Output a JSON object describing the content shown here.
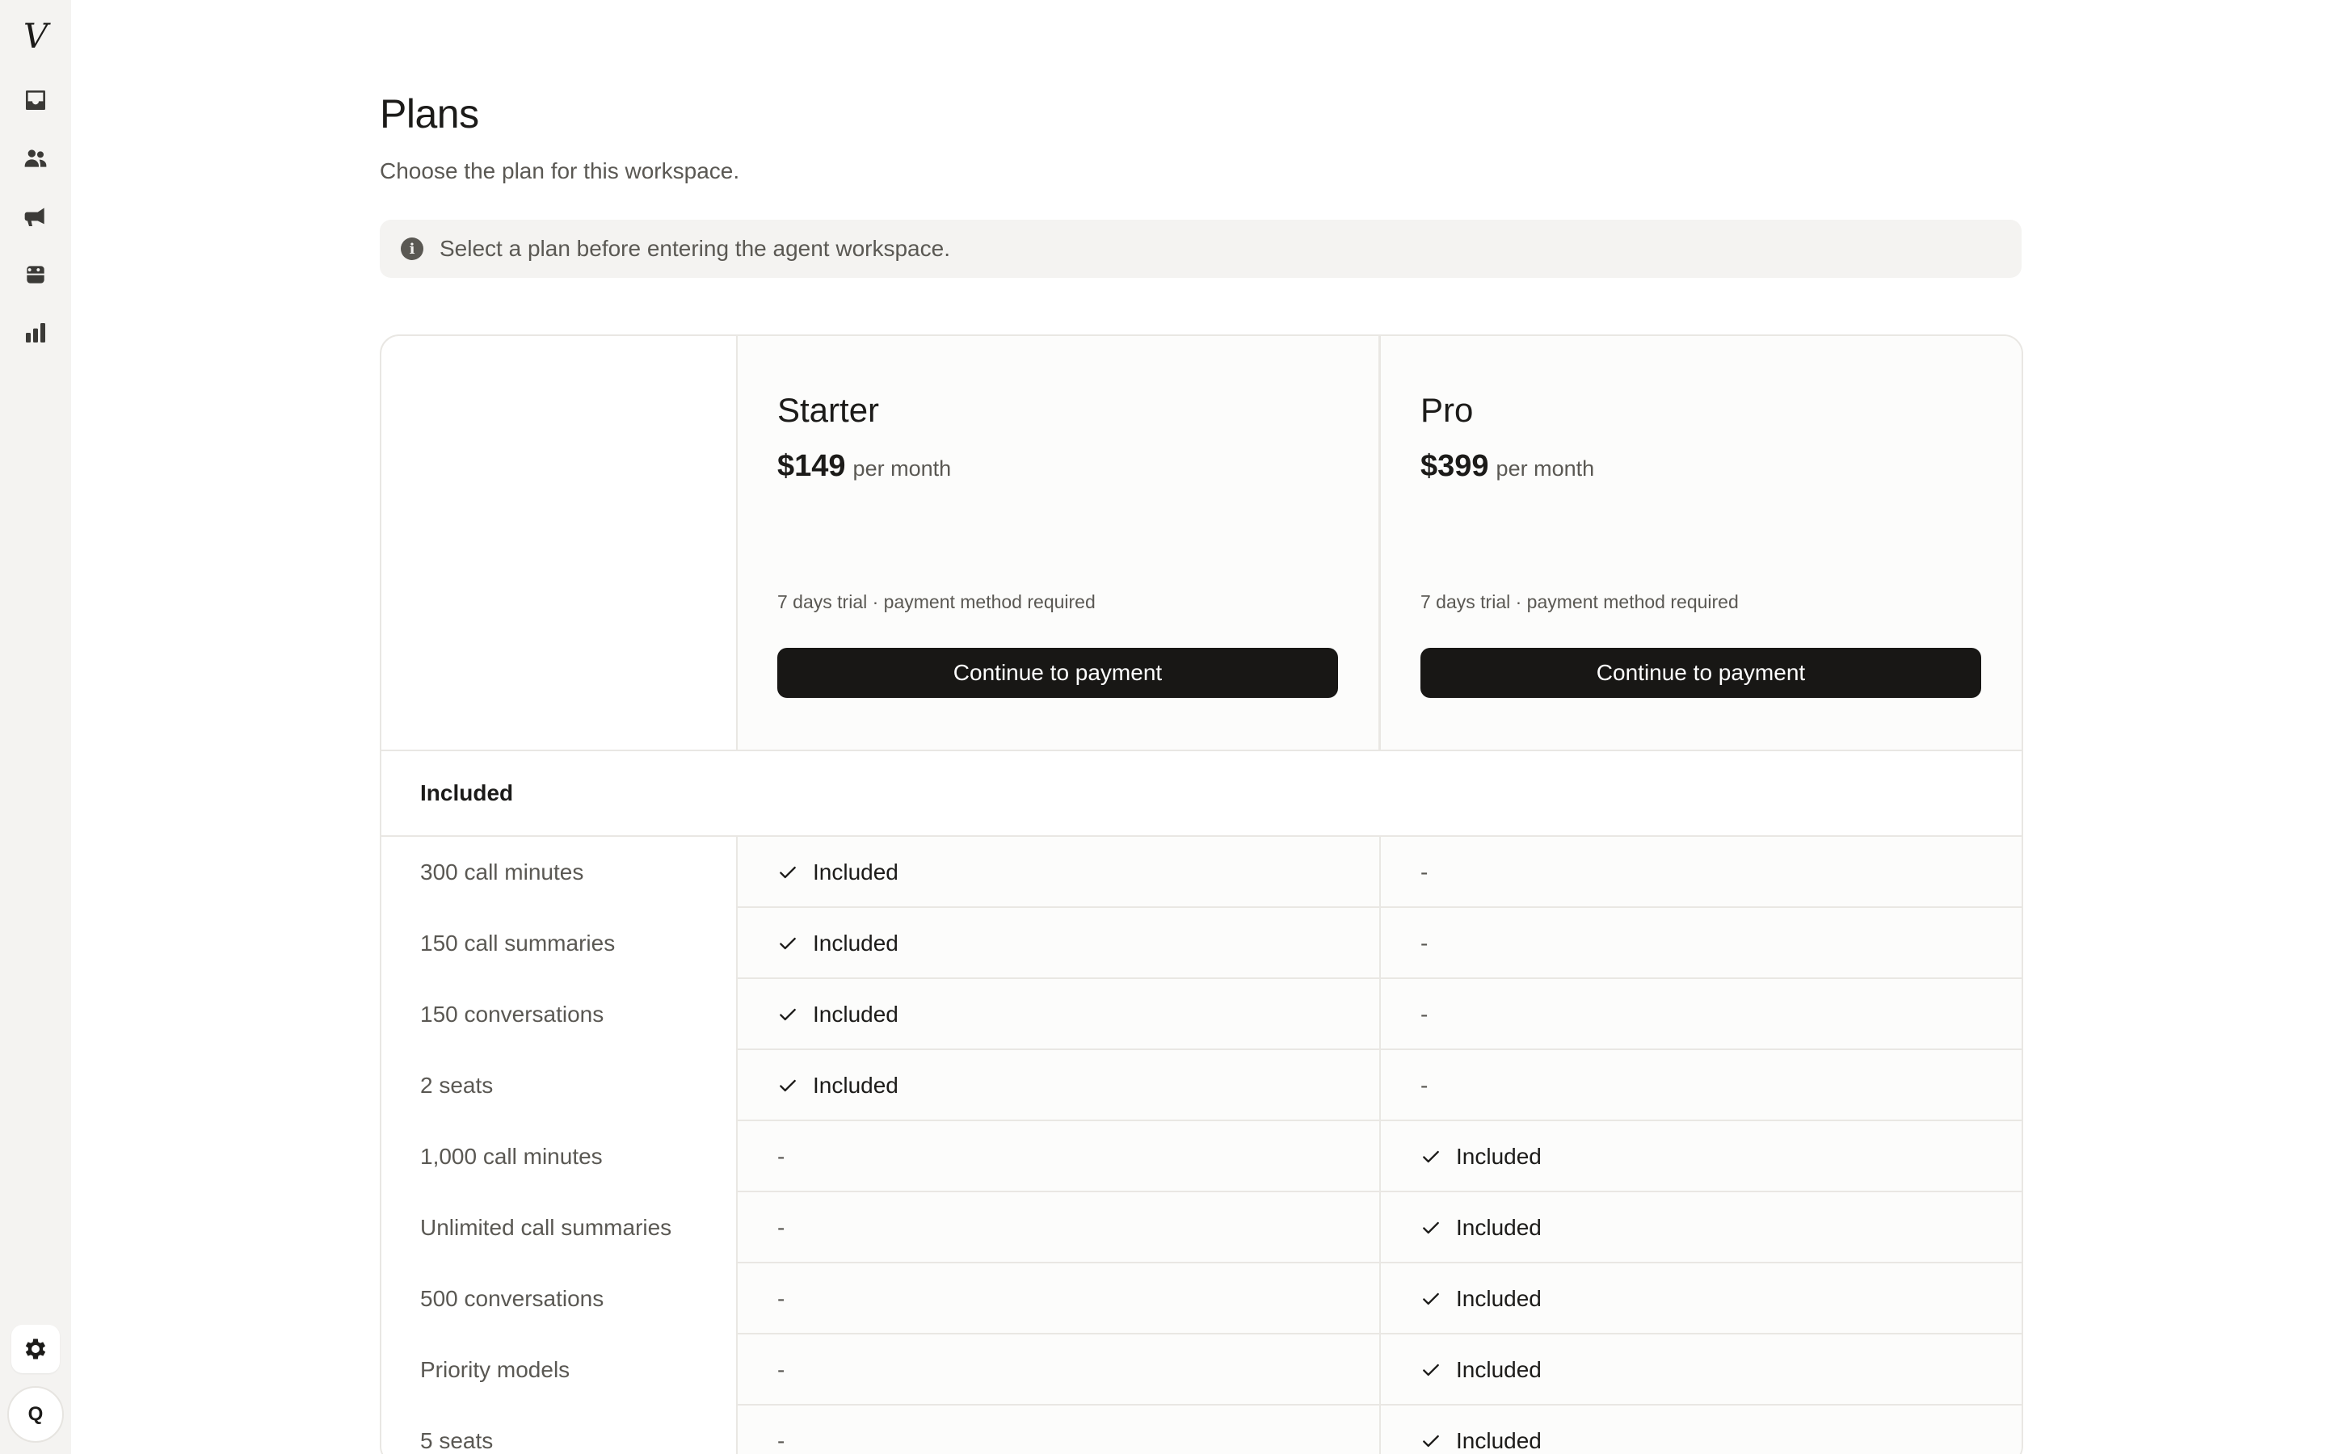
{
  "sidebar": {
    "logo": "V",
    "icons": [
      "inbox-icon",
      "contacts-icon",
      "megaphone-icon",
      "bot-icon",
      "analytics-icon"
    ],
    "settings_icon": "gear-icon",
    "avatar_initial": "Q"
  },
  "header": {
    "title": "Plans",
    "subtitle": "Choose the plan for this workspace."
  },
  "notice": {
    "icon": "info-icon",
    "text": "Select a plan before entering the agent workspace."
  },
  "plans": [
    {
      "name": "Starter",
      "price": "$149",
      "period": "per month",
      "trial": "7 days trial · payment method required",
      "cta": "Continue to payment"
    },
    {
      "name": "Pro",
      "price": "$399",
      "period": "per month",
      "trial": "7 days trial · payment method required",
      "cta": "Continue to payment"
    }
  ],
  "section_title": "Included",
  "features": [
    {
      "label": "300 call minutes",
      "starter": "Included",
      "pro": "-"
    },
    {
      "label": "150 call summaries",
      "starter": "Included",
      "pro": "-"
    },
    {
      "label": "150 conversations",
      "starter": "Included",
      "pro": "-"
    },
    {
      "label": "2 seats",
      "starter": "Included",
      "pro": "-"
    },
    {
      "label": "1,000 call minutes",
      "starter": "-",
      "pro": "Included"
    },
    {
      "label": "Unlimited call summaries",
      "starter": "-",
      "pro": "Included"
    },
    {
      "label": "500 conversations",
      "starter": "-",
      "pro": "Included"
    },
    {
      "label": "Priority models",
      "starter": "-",
      "pro": "Included"
    },
    {
      "label": "5 seats",
      "starter": "-",
      "pro": "Included"
    }
  ],
  "colors": {
    "sidebar_bg": "#f4f3f1",
    "button_bg": "#181715",
    "border": "#e9e7e3",
    "muted_text": "#5a5853"
  }
}
